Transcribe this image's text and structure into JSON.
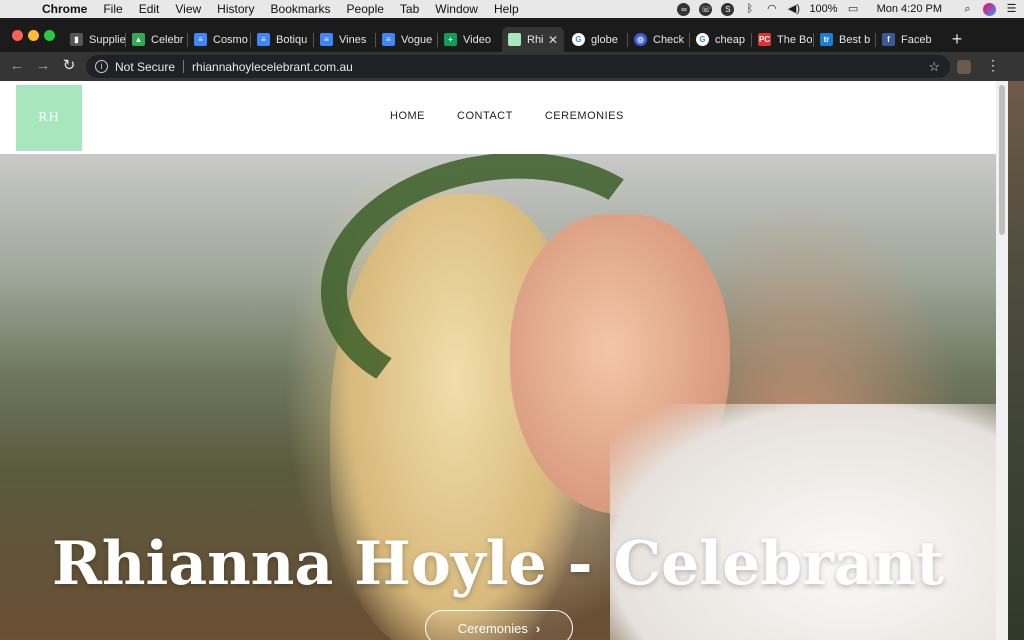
{
  "menubar": {
    "apple": "",
    "items": [
      "Chrome",
      "File",
      "Edit",
      "View",
      "History",
      "Bookmarks",
      "People",
      "Tab",
      "Window",
      "Help"
    ],
    "battery": "100%",
    "clock": "Mon 4:20 PM"
  },
  "tabs": [
    {
      "label": "Supplie",
      "fav_color": "#555555",
      "fav_char": "▮"
    },
    {
      "label": "Celebr",
      "fav_color": "#34a853",
      "fav_char": "▲"
    },
    {
      "label": "Cosmo",
      "fav_color": "#4285f4",
      "fav_char": "≡"
    },
    {
      "label": "Botiqu",
      "fav_color": "#4285f4",
      "fav_char": "≡"
    },
    {
      "label": "Vines",
      "fav_color": "#4285f4",
      "fav_char": "≡"
    },
    {
      "label": "Vogue",
      "fav_color": "#4285f4",
      "fav_char": "≡"
    },
    {
      "label": "Video",
      "fav_color": "#0f9d58",
      "fav_char": "+"
    },
    {
      "label": "Rhi",
      "fav_color": "#a8e6bd",
      "fav_char": "",
      "active": true
    },
    {
      "label": "globe",
      "fav_color": "#ffffff",
      "fav_char": "G"
    },
    {
      "label": "Check",
      "fav_color": "#3b5bdb",
      "fav_char": "◎"
    },
    {
      "label": "cheap",
      "fav_color": "#ffffff",
      "fav_char": "G"
    },
    {
      "label": "The Bo",
      "fav_color": "#e03131",
      "fav_char": "PC"
    },
    {
      "label": "Best b",
      "fav_color": "#1c7ed6",
      "fav_char": "tr"
    },
    {
      "label": "Faceb",
      "fav_color": "#3b5998",
      "fav_char": "f"
    }
  ],
  "toolbar": {
    "security": "Not Secure",
    "url": "rhiannahoylecelebrant.com.au"
  },
  "site": {
    "logo": "RH",
    "nav": [
      "HOME",
      "CONTACT",
      "CEREMONIES"
    ],
    "hero_title": "Rhianna Hoyle - Celebrant",
    "hero_button": "Ceremonies"
  },
  "icons": {
    "apple": "apple-icon",
    "wifi": "wifi-icon",
    "volume": "volume-icon",
    "battery": "battery-icon",
    "search": "spotlight-icon",
    "list": "notification-list-icon"
  }
}
